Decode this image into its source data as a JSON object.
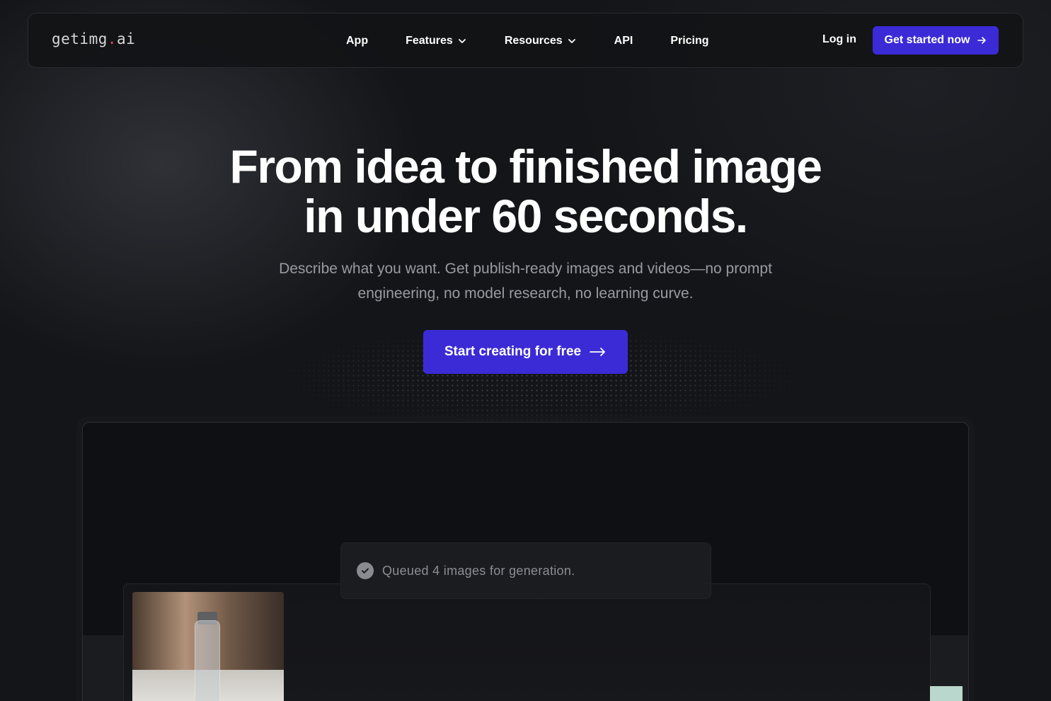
{
  "brand": {
    "logo_prefix": "getimg",
    "logo_dot": ".",
    "logo_suffix": "ai"
  },
  "nav": {
    "items": [
      {
        "label": "App",
        "has_dropdown": false
      },
      {
        "label": "Features",
        "has_dropdown": true
      },
      {
        "label": "Resources",
        "has_dropdown": true
      },
      {
        "label": "API",
        "has_dropdown": false
      },
      {
        "label": "Pricing",
        "has_dropdown": false
      }
    ],
    "login_label": "Log in",
    "cta_label": "Get started now",
    "cta_icon": "arrow-right-icon"
  },
  "hero": {
    "title_line1": "From idea to finished image",
    "title_line2": "in under 60 seconds.",
    "subtitle_line1": "Describe what you want. Get publish-ready images and videos—no prompt",
    "subtitle_line2": "engineering, no model research, no learning curve.",
    "cta_label": "Start creating for free",
    "cta_icon": "long-arrow-right-icon"
  },
  "preview": {
    "toast_text": "Queued 4 images for generation.",
    "toast_icon": "check-circle-icon"
  },
  "colors": {
    "accent": "#3b2bd6",
    "background": "#141518",
    "logo_dot": "#e0475b",
    "muted_text": "#9a9ba2"
  }
}
